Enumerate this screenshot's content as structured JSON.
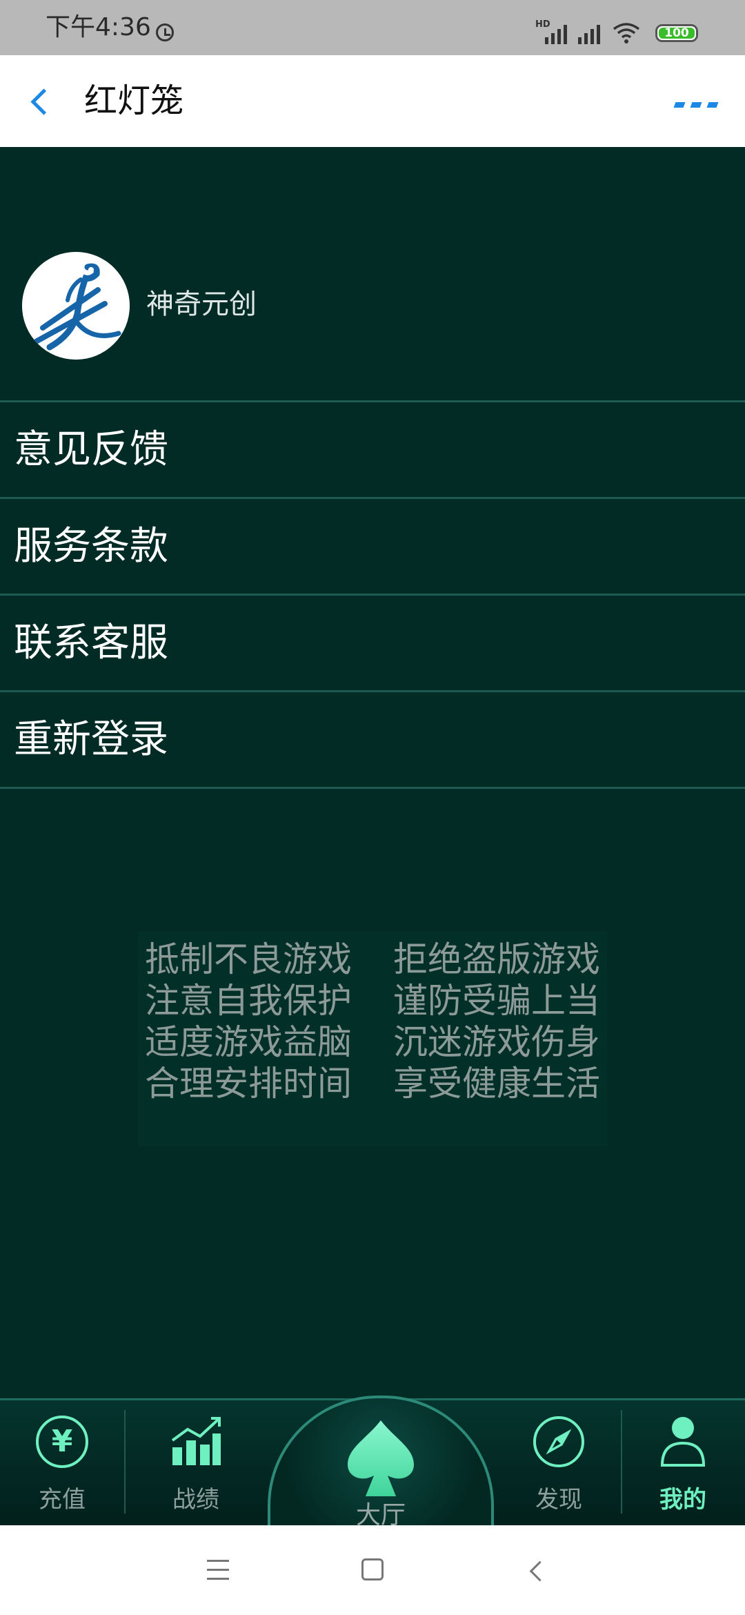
{
  "status_bar": {
    "time": "下午4:36",
    "hd_label": "HD",
    "battery": "100"
  },
  "header": {
    "title": "红灯笼"
  },
  "profile": {
    "name": "神奇元创"
  },
  "menu": {
    "items": [
      {
        "label": "意见反馈"
      },
      {
        "label": "服务条款"
      },
      {
        "label": "联系客服"
      },
      {
        "label": "重新登录"
      }
    ]
  },
  "notice": {
    "lines": [
      [
        "抵制不良游戏",
        "拒绝盗版游戏"
      ],
      [
        "注意自我保护",
        "谨防受骗上当"
      ],
      [
        "适度游戏益脑",
        "沉迷游戏伤身"
      ],
      [
        "合理安排时间",
        "享受健康生活"
      ]
    ]
  },
  "bottom_nav": {
    "items": [
      {
        "label": "充值",
        "icon": "yen-icon",
        "glyph": "¥"
      },
      {
        "label": "战绩",
        "icon": "chart-icon"
      },
      {
        "label": "大厅",
        "icon": "spade-icon"
      },
      {
        "label": "发现",
        "icon": "compass-icon"
      },
      {
        "label": "我的",
        "icon": "person-icon",
        "active": true
      }
    ]
  },
  "colors": {
    "background": "#022b26",
    "accent": "#6ff0c1",
    "header_accent": "#1e88e5"
  }
}
